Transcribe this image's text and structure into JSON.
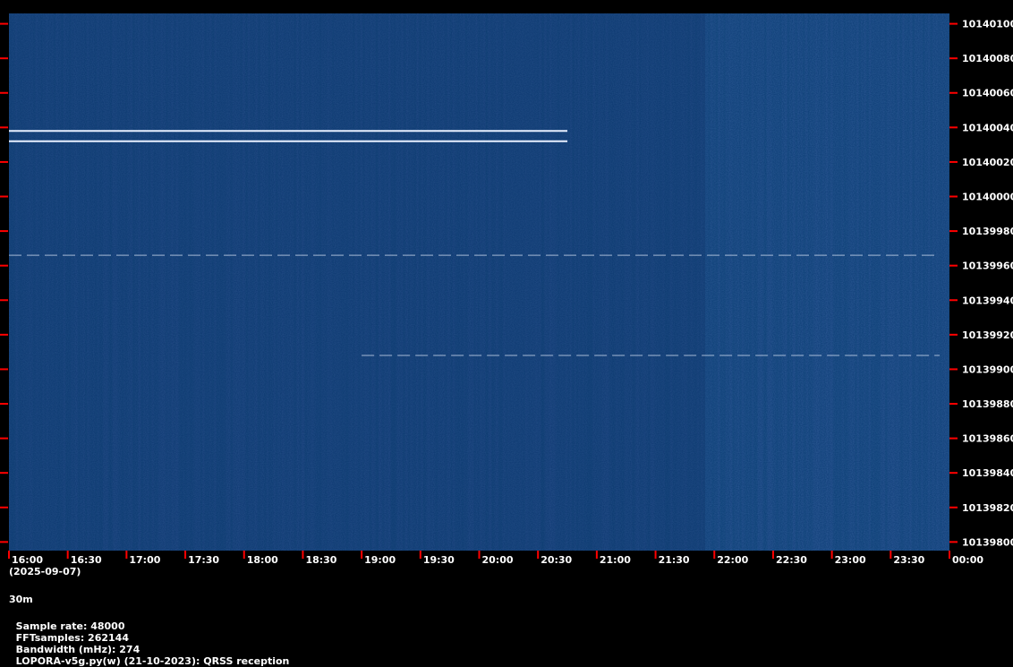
{
  "chart_data": {
    "type": "heatmap",
    "title": "",
    "xlabel": "",
    "ylabel": "",
    "x_ticks": [
      "16:00",
      "16:30",
      "17:00",
      "17:30",
      "18:00",
      "18:30",
      "19:00",
      "19:30",
      "20:00",
      "20:30",
      "21:00",
      "21:30",
      "22:00",
      "22:30",
      "23:00",
      "23:30",
      "00:00"
    ],
    "y_ticks": [
      10140100,
      10140080,
      10140060,
      10140040,
      10140020,
      10140000,
      10139980,
      10139960,
      10139940,
      10139920,
      10139900,
      10139880,
      10139860,
      10139840,
      10139820,
      10139800
    ],
    "xlim": [
      "16:00",
      "00:00"
    ],
    "ylim": [
      10139795,
      10140106
    ],
    "grid": false,
    "colors": {
      "background": "#0f3a78",
      "trace": "#e8f0ff",
      "tick": "#ff0000"
    },
    "traces": [
      {
        "start": "16:00",
        "end": "20:45",
        "freq": 10140038
      },
      {
        "start": "16:00",
        "end": "20:45",
        "freq": 10140032
      },
      {
        "start": "16:00",
        "end": "23:55",
        "freq": 10139966,
        "dashed": true
      },
      {
        "start": "19:00",
        "end": "23:55",
        "freq": 10139908,
        "dashed": true
      }
    ]
  },
  "date": "(2025-09-07)",
  "band": "30m",
  "info": {
    "sample_rate": "Sample rate: 48000",
    "fft_samples": "FFTsamples: 262144",
    "bandwidth": "Bandwidth (mHz): 274",
    "software": "LOPORA-v5g.py(w) (21-10-2023): QRSS reception"
  }
}
